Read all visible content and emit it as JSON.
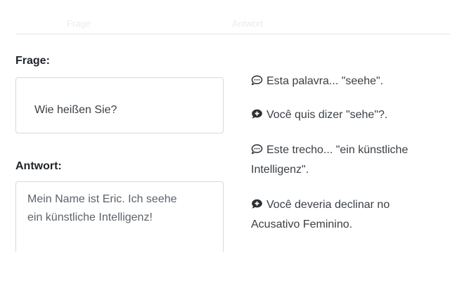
{
  "header": {
    "ghost_left": "Frage",
    "ghost_right": "Antwort"
  },
  "question": {
    "label": "Frage:",
    "text": "Wie heißen Sie?"
  },
  "answer": {
    "label": "Antwort:",
    "line1": "Mein Name ist Eric. Ich seehe",
    "line2": "ein künstliche Intelligenz!"
  },
  "feedback": [
    {
      "icon": "comment-outline-icon",
      "text": "Esta palavra... \"seehe\"."
    },
    {
      "icon": "comment-plus-icon",
      "text": "Você quis dizer \"sehe\"?."
    },
    {
      "icon": "comment-outline-icon",
      "text_line1": "Este trecho... \"ein künstliche",
      "text_line2": "Intelligenz\"."
    },
    {
      "icon": "comment-plus-icon",
      "text_line1": "Você deveria declinar no",
      "text_line2": "Acusativo Feminino."
    }
  ],
  "colors": {
    "text": "#3a3f44",
    "heading": "#212529",
    "border": "#d6d9dd",
    "icon": "#2b2f33"
  }
}
